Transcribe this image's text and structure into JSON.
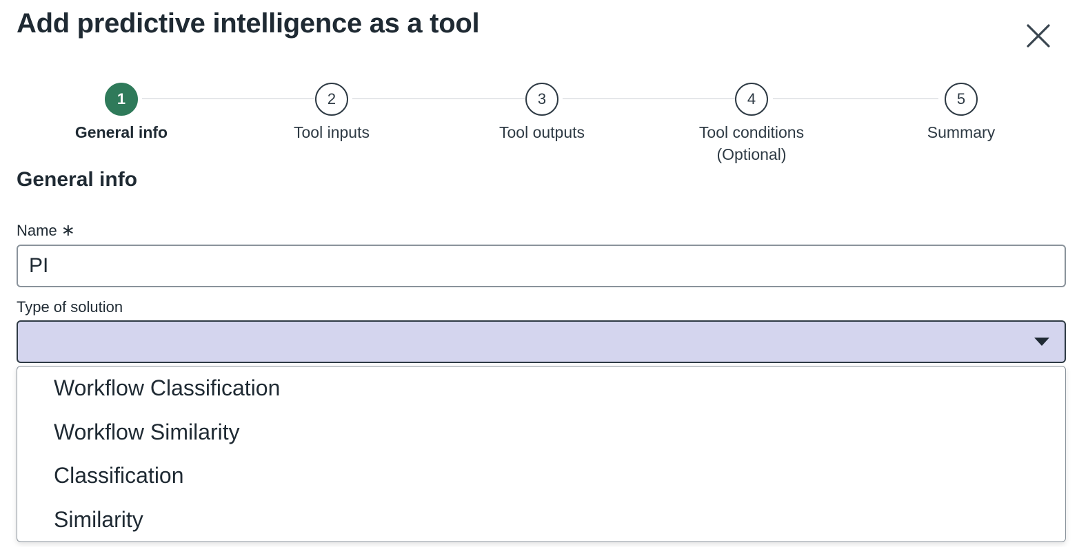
{
  "modal": {
    "title": "Add predictive intelligence as a tool"
  },
  "stepper": {
    "steps": [
      {
        "number": "1",
        "label": "General info",
        "active": true
      },
      {
        "number": "2",
        "label": "Tool inputs",
        "active": false
      },
      {
        "number": "3",
        "label": "Tool outputs",
        "active": false
      },
      {
        "number": "4",
        "label": "Tool conditions",
        "sublabel": "(Optional)",
        "active": false
      },
      {
        "number": "5",
        "label": "Summary",
        "active": false
      }
    ]
  },
  "section": {
    "title": "General info"
  },
  "form": {
    "name_label": "Name",
    "required_mark": "∗",
    "name_value": "PI",
    "type_label": "Type of solution",
    "type_value": ""
  },
  "dropdown": {
    "options": [
      "Workflow Classification",
      "Workflow Similarity",
      "Classification",
      "Similarity"
    ]
  },
  "colors": {
    "active_step": "#2f7a5a",
    "select_background": "#d4d5ee"
  }
}
